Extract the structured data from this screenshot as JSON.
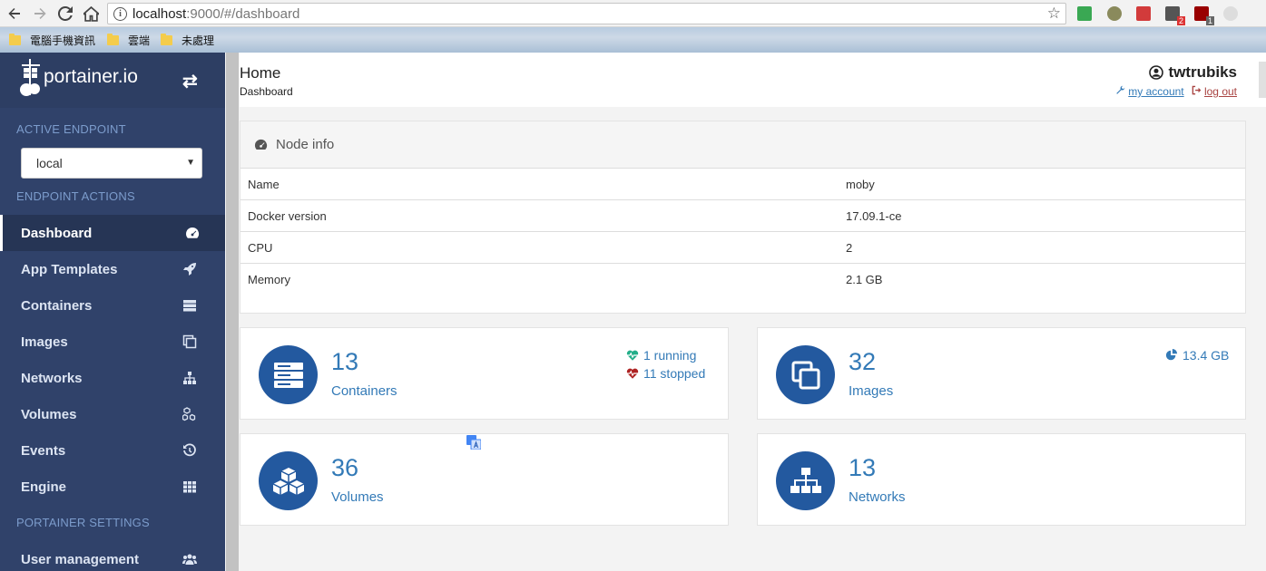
{
  "browser": {
    "url_host": "localhost",
    "url_path": ":9000/#/dashboard",
    "bookmarks": [
      "電腦手機資訊",
      "雲端",
      "未處理"
    ],
    "ext_badges": [
      "2",
      "1"
    ]
  },
  "sidebar": {
    "brand": "portainer.io",
    "active_endpoint_title": "ACTIVE ENDPOINT",
    "endpoint_value": "local",
    "endpoint_actions_title": "ENDPOINT ACTIONS",
    "items": [
      {
        "label": "Dashboard",
        "icon": "tachometer-icon"
      },
      {
        "label": "App Templates",
        "icon": "rocket-icon"
      },
      {
        "label": "Containers",
        "icon": "server-icon"
      },
      {
        "label": "Images",
        "icon": "clone-icon"
      },
      {
        "label": "Networks",
        "icon": "sitemap-icon"
      },
      {
        "label": "Volumes",
        "icon": "cubes-icon"
      },
      {
        "label": "Events",
        "icon": "history-icon"
      },
      {
        "label": "Engine",
        "icon": "th-icon"
      }
    ],
    "settings_title": "PORTAINER SETTINGS",
    "settings_items": [
      {
        "label": "User management",
        "icon": "users-icon"
      }
    ]
  },
  "header": {
    "title": "Home",
    "subtitle": "Dashboard",
    "username": "twtrubiks",
    "my_account": "my account",
    "log_out": "log out"
  },
  "node_info": {
    "title": "Node info",
    "rows": [
      {
        "key": "Name",
        "value": "moby"
      },
      {
        "key": "Docker version",
        "value": "17.09.1-ce"
      },
      {
        "key": "CPU",
        "value": "2"
      },
      {
        "key": "Memory",
        "value": "2.1 GB"
      }
    ]
  },
  "widgets": {
    "containers": {
      "count": "13",
      "label": "Containers",
      "running": "1 running",
      "stopped": "11 stopped"
    },
    "images": {
      "count": "32",
      "label": "Images",
      "size": "13.4 GB"
    },
    "volumes": {
      "count": "36",
      "label": "Volumes"
    },
    "networks": {
      "count": "13",
      "label": "Networks"
    }
  },
  "colors": {
    "sidebar": "#30426a",
    "accent": "#337ab7",
    "circle": "#23599f",
    "running": "#23ae89",
    "stopped": "#ae2323"
  }
}
